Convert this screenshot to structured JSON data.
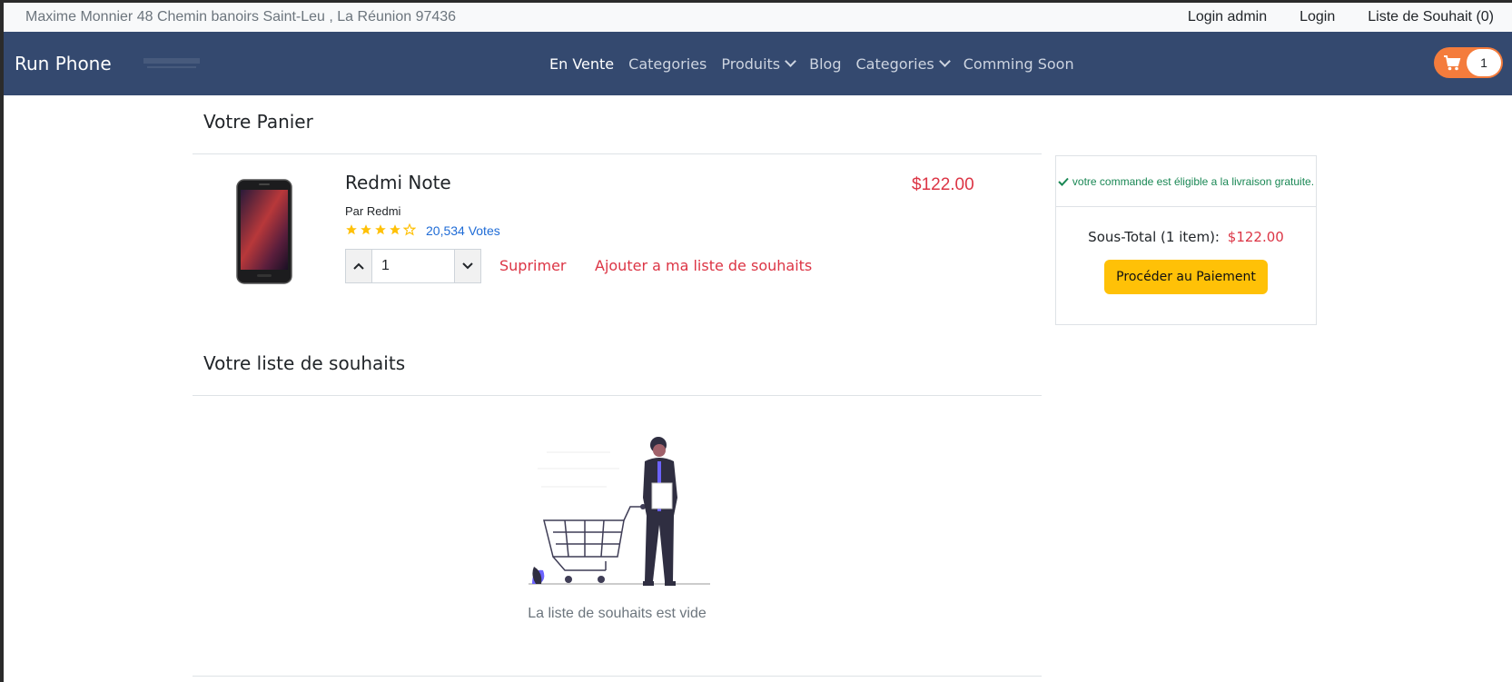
{
  "topbar": {
    "address": "Maxime Monnier 48 Chemin banoirs Saint-Leu , La Réunion 97436",
    "login_admin": "Login admin",
    "login": "Login",
    "wishlist": "Liste de Souhait (0)"
  },
  "navbar": {
    "brand": "Run Phone",
    "items": [
      "En Vente",
      "Categories",
      "Produits",
      "Blog",
      "Categories",
      "Comming Soon"
    ],
    "cart_count": "1",
    "colors": {
      "background": "#34496f",
      "cart": "#f47c3c"
    }
  },
  "cart": {
    "title": "Votre Panier",
    "item": {
      "name": "Redmi Note",
      "brand": "Par Redmi",
      "rating": 4,
      "rating_max": 5,
      "votes": "20,534 Votes",
      "price": "$122.00",
      "quantity": "1",
      "remove_label": "Suprimer",
      "wishlist_label": "Ajouter a ma liste de souhaits"
    }
  },
  "summary": {
    "eligible": "votre commande est éligible a la livraison gratuite.",
    "subtotal_label": "Sous-Total (1 item):",
    "subtotal_amount": "$122.00",
    "pay_button": "Procéder au Paiement"
  },
  "wishlist": {
    "title": "Votre liste de souhaits",
    "empty_text": "La liste de souhaits est vide"
  }
}
